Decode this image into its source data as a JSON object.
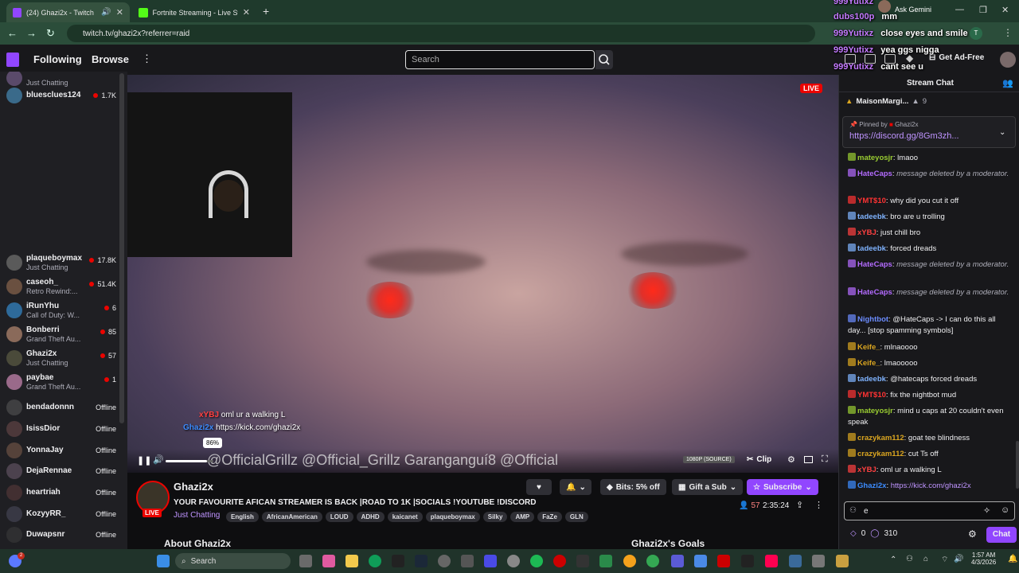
{
  "browser": {
    "tabs": [
      {
        "label": "(24) Ghazi2x - Twitch",
        "active": true
      },
      {
        "label": "Fortnite Streaming - Live Strea",
        "active": false
      }
    ],
    "url": "twitch.tv/ghazi2x?referrer=raid",
    "ask_gemini": "Ask Gemini"
  },
  "twitch_nav": {
    "following": "Following",
    "browse": "Browse",
    "more": "⋮",
    "search_placeholder": "Search",
    "get_ad_free": "Get Ad-Free"
  },
  "sidebar": {
    "channels": [
      {
        "name": "",
        "game": "Just Chatting",
        "viewers": "",
        "color": "#5a4a6a"
      },
      {
        "name": "bluesclues124",
        "game": "",
        "viewers": "1.7K",
        "color": "#3a6a8a"
      },
      {
        "name": "plaqueboymax",
        "game": "Just Chatting",
        "viewers": "17.8K",
        "color": "#5a5a5a"
      },
      {
        "name": "caseoh_",
        "game": "Retro Rewind:...",
        "viewers": "51.4K",
        "color": "#6a5040"
      },
      {
        "name": "iRunYhu",
        "game": "Call of Duty: W...",
        "viewers": "6",
        "color": "#2e6a9a"
      },
      {
        "name": "Bonberri",
        "game": "Grand Theft Au...",
        "viewers": "85",
        "color": "#8a6a5a"
      },
      {
        "name": "Ghazi2x",
        "game": "Just Chatting",
        "viewers": "57",
        "color": "#4a4a3a"
      },
      {
        "name": "paybae",
        "game": "Grand Theft Au...",
        "viewers": "1",
        "color": "#9a6a8a"
      },
      {
        "name": "bendadonnn",
        "game": "",
        "viewers": "Offline",
        "color": "#555"
      },
      {
        "name": "IsissDior",
        "game": "",
        "viewers": "Offline",
        "color": "#6a4a4a"
      },
      {
        "name": "YonnaJay",
        "game": "",
        "viewers": "Offline",
        "color": "#7a5a4a"
      },
      {
        "name": "DejaRennae",
        "game": "",
        "viewers": "Offline",
        "color": "#6a5a6a"
      },
      {
        "name": "heartriah",
        "game": "",
        "viewers": "Offline",
        "color": "#5a3a3a"
      },
      {
        "name": "KozyyRR_",
        "game": "",
        "viewers": "Offline",
        "color": "#4a4a5a"
      },
      {
        "name": "Duwapsnr",
        "game": "",
        "viewers": "Offline",
        "color": "#3a3a3a"
      }
    ]
  },
  "video": {
    "live_badge": "LIVE",
    "overlay_msgs": [
      {
        "user": "xYBJ",
        "text": "oml ur a walking L"
      },
      {
        "user": "Ghazi2x",
        "text": "https://kick.com/ghazi2x"
      }
    ],
    "volume_tooltip": "86%",
    "volume_fraction": 0.86,
    "overlay_socials": "@OfficialGrillz   @Official_Grillz   Garanganguí8   @Official",
    "quality": "1080P (SOURCE)",
    "clip": "Clip"
  },
  "stream_info": {
    "streamer": "Ghazi2x",
    "live": "LIVE",
    "title": "YOUR FAVOURITE AFICAN STREAMER IS BACK |ROAD TO 1K |SOCIALS !YOUTUBE !DISCORD",
    "category": "Just Chatting",
    "tags": [
      "English",
      "AfricanAmerican",
      "LOUD",
      "ADHD",
      "kaicanet",
      "plaqueboymax",
      "Silky",
      "AMP",
      "FaZe",
      "GLN"
    ],
    "viewers": "57",
    "uptime": "2:35:24",
    "bits": "Bits: 5% off",
    "gift": "Gift a Sub",
    "subscribe": "Subscribe",
    "about": "About Ghazi2x",
    "goals": "Ghazi2x's Goals"
  },
  "chat": {
    "header": "Stream Chat",
    "top_gifter": "MaisonMargi...",
    "top_gifter_count": "9",
    "pinned_by": "Pinned by",
    "pinned_user": "Ghazi2x",
    "pinned_link": "https://discord.gg/8Gm3zh...",
    "messages": [
      {
        "user": "mateyosjr",
        "color": "#9acd32",
        "text": "lmaoo",
        "deleted": false
      },
      {
        "user": "HateCaps",
        "color": "#b36bff",
        "text": "message deleted by a moderator.",
        "deleted": true
      },
      {
        "user": "YMT$10",
        "color": "#ff3333",
        "text": "why did you cut it off",
        "deleted": false
      },
      {
        "user": "tadeebk",
        "color": "#7fb3ff",
        "text": "bro are u trolling",
        "deleted": false
      },
      {
        "user": "xYBJ",
        "color": "#ff4040",
        "text": "just chill bro",
        "deleted": false
      },
      {
        "user": "tadeebk",
        "color": "#7fb3ff",
        "text": "forced dreads",
        "deleted": false
      },
      {
        "user": "HateCaps",
        "color": "#b36bff",
        "text": "message deleted by a moderator.",
        "deleted": true
      },
      {
        "user": "HateCaps",
        "color": "#b36bff",
        "text": "message deleted by a moderator.",
        "deleted": true
      },
      {
        "user": "Nightbot",
        "color": "#6b8cff",
        "text": "@HateCaps -> I can do this all day... [stop spamming symbols]",
        "deleted": false
      },
      {
        "user": "Keife_",
        "color": "#daa520",
        "text": "mlnaoooo",
        "deleted": false
      },
      {
        "user": "Keife_",
        "color": "#daa520",
        "text": "lmaooooo",
        "deleted": false
      },
      {
        "user": "tadeebk",
        "color": "#7fb3ff",
        "text": "@hatecaps forced dreads",
        "deleted": false
      },
      {
        "user": "YMT$10",
        "color": "#ff3333",
        "text": "fix the nightbot mud",
        "deleted": false
      },
      {
        "user": "mateyosjr",
        "color": "#9acd32",
        "text": "mind u caps at 20 couldn't even speak",
        "deleted": false
      },
      {
        "user": "crazykam112",
        "color": "#daa520",
        "text": "goat tee blindness",
        "deleted": false
      },
      {
        "user": "crazykam112",
        "color": "#daa520",
        "text": "cut Ts off",
        "deleted": false
      },
      {
        "user": "xYBJ",
        "color": "#ff4040",
        "text": "oml ur a walking L",
        "deleted": false
      },
      {
        "user": "Ghazi2x",
        "color": "#3c8cff",
        "text": "https://kick.com/ghazi2x",
        "deleted": false
      }
    ],
    "input_value": "e",
    "points": "0",
    "channel_points": "310",
    "chat_button": "Chat"
  },
  "overlay_chat": [
    {
      "user": "999Yutixz",
      "text": ""
    },
    {
      "user": "dubs100p",
      "text": "mm"
    },
    {
      "user": "999Yutixz",
      "text": "close eyes and smile"
    },
    {
      "user": "999Yutixz",
      "text": "yea ggs nigga"
    },
    {
      "user": "999Yutixz",
      "text": "cant see u"
    }
  ],
  "taskbar": {
    "search": "Search",
    "time": "1:57 AM",
    "date": "4/3/2026",
    "notif_badge": "2"
  }
}
